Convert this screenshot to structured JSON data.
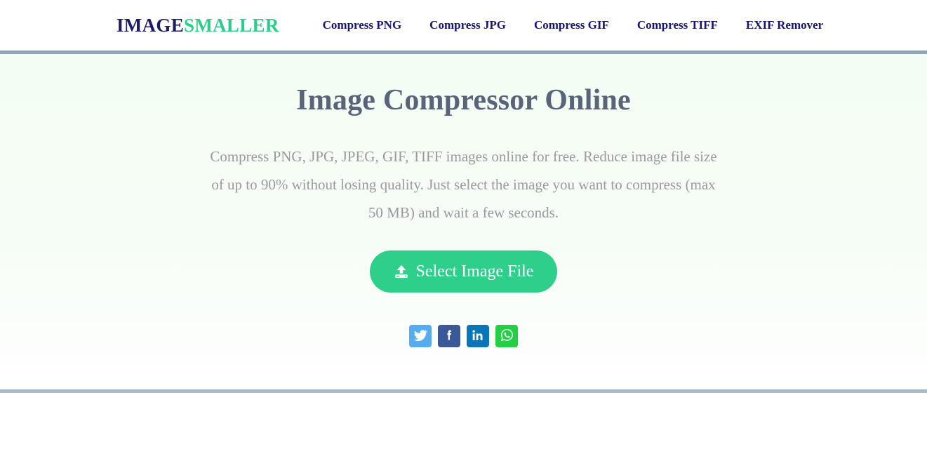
{
  "header": {
    "brand": {
      "part_one": "IMAGE",
      "part_two": "SMALLER",
      "color_part_one": "#1b1b63",
      "color_part_two": "#2ecc8a"
    },
    "nav": [
      {
        "label": "Compress PNG"
      },
      {
        "label": "Compress JPG"
      },
      {
        "label": "Compress GIF"
      },
      {
        "label": "Compress TIFF"
      },
      {
        "label": "EXIF Remover"
      }
    ],
    "rule_color": "#8fa5b6"
  },
  "hero": {
    "title": "Image Compressor Online",
    "description": "Compress PNG, JPG, JPEG, GIF, TIFF images online for free. Reduce image file size of up to 90% without losing quality. Just select the image you want to compress (max 50 MB) and wait a few seconds.",
    "title_color": "#5a6478",
    "background_color": "#f4fdf4",
    "select_button": {
      "label": "Select Image File",
      "icon": "upload-icon",
      "color": "#2ecf8b"
    },
    "social": [
      {
        "name": "twitter-share-button",
        "icon": "twitter-icon",
        "color": "#55acee"
      },
      {
        "name": "facebook-share-button",
        "icon": "facebook-icon",
        "color": "#3b5998"
      },
      {
        "name": "linkedin-share-button",
        "icon": "linkedin-icon",
        "color": "#0b76b7"
      },
      {
        "name": "whatsapp-share-button",
        "icon": "whatsapp-icon",
        "color": "#25cf43"
      }
    ]
  },
  "footer_divider": {
    "color": "#a9bcc9"
  }
}
